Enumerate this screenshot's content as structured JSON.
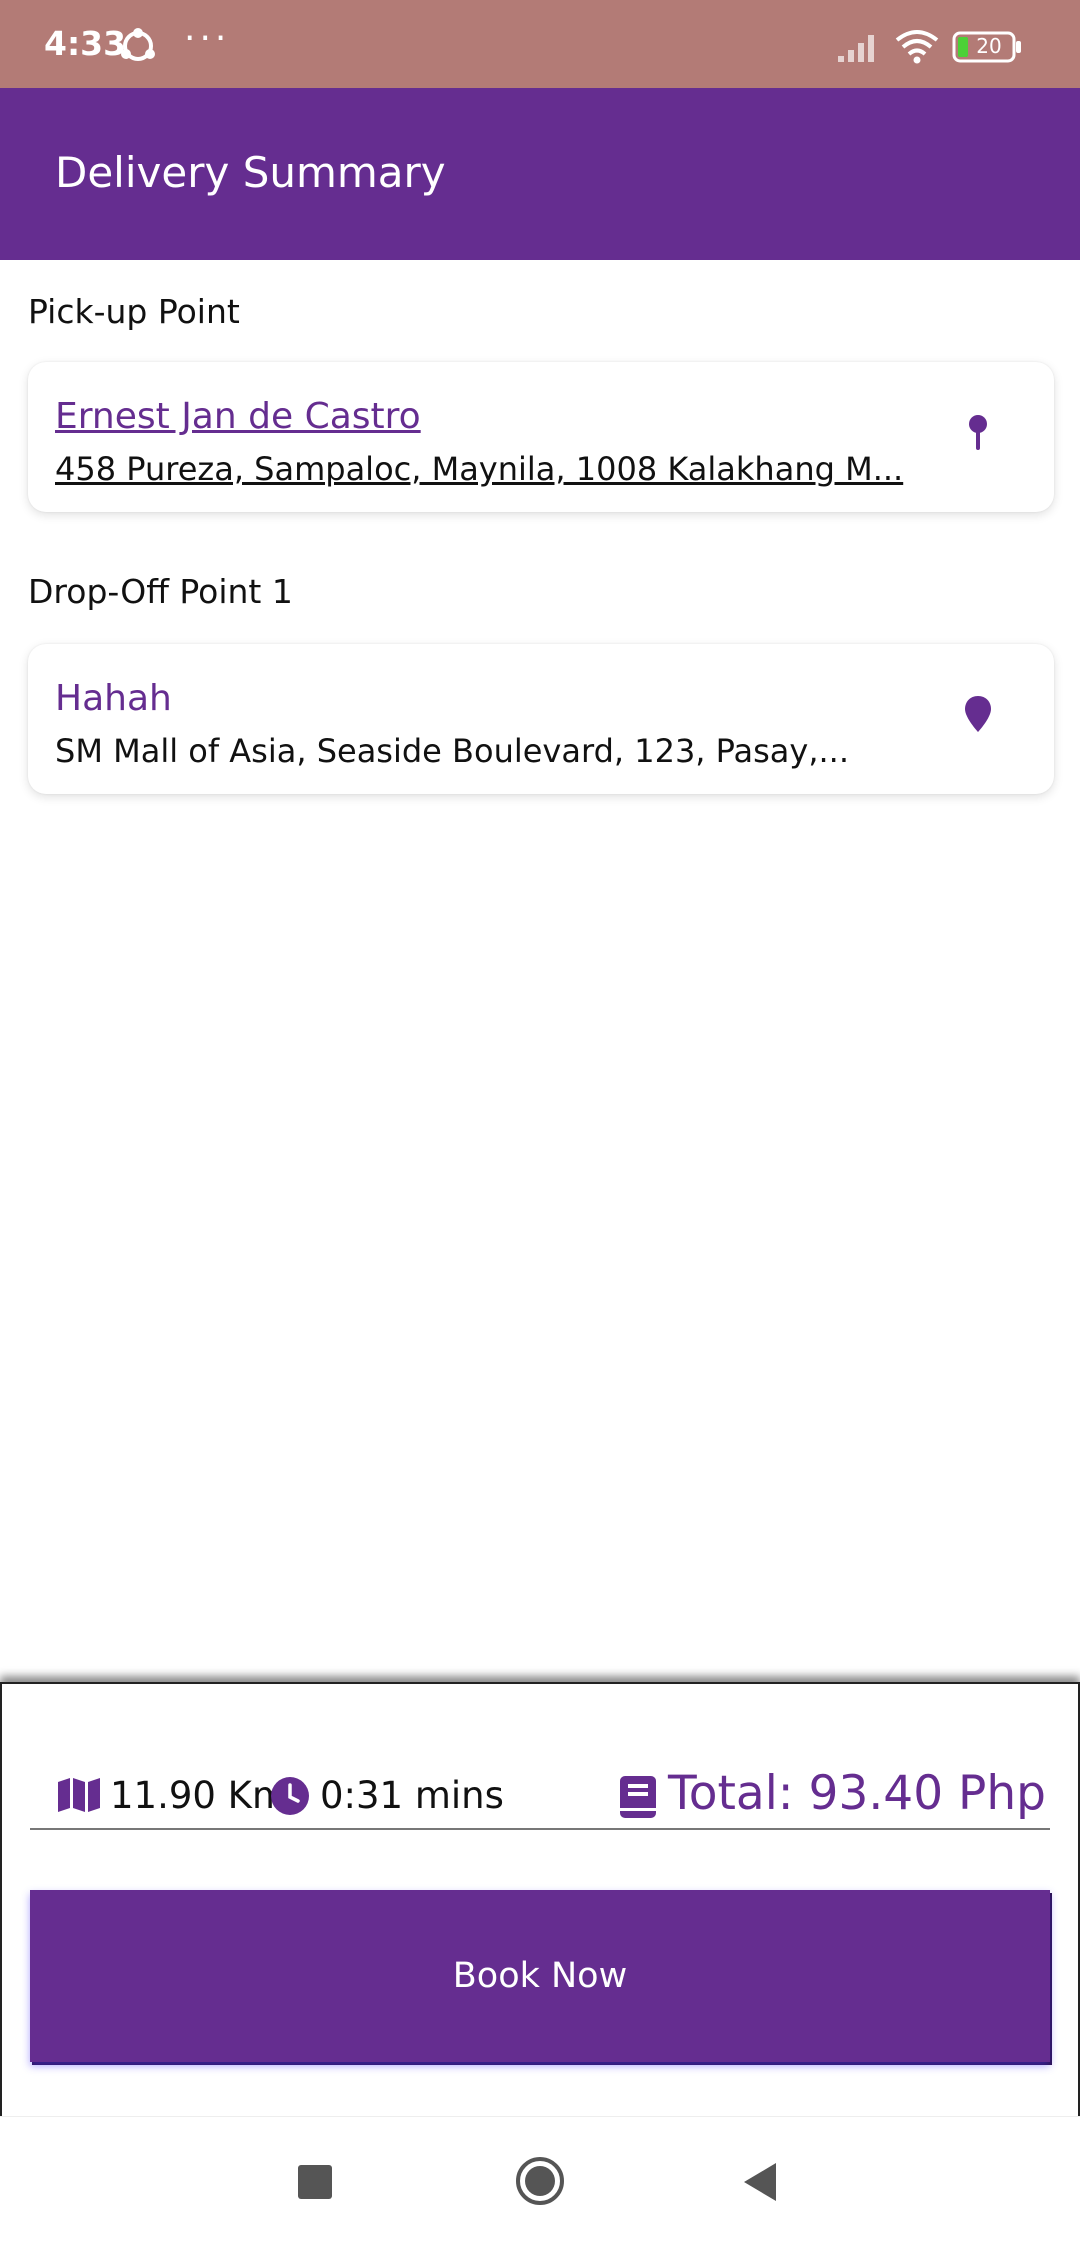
{
  "status_bar": {
    "time": "4:33",
    "more_dots": "···",
    "battery_level": "20",
    "icons": [
      "sync-icon",
      "signal-icon",
      "wifi-icon",
      "battery-icon"
    ]
  },
  "app_bar": {
    "title": "Delivery Summary"
  },
  "pickup": {
    "section_label": "Pick-up Point",
    "name": "Ernest Jan de Castro",
    "address": "458 Pureza, Sampaloc, Maynila, 1008 Kalakhang M...",
    "icon": "map-pin-icon"
  },
  "dropoff": {
    "section_label": "Drop-Off Point 1",
    "name": "Hahah",
    "address": "SM Mall of Asia, Seaside Boulevard, 123, Pasay,...",
    "icon": "map-marker-icon"
  },
  "summary": {
    "distance": "11.90 Km",
    "duration": "0:31 mins",
    "total": "Total: 93.40 Php",
    "icons": [
      "map-icon",
      "clock-icon",
      "receipt-icon"
    ]
  },
  "actions": {
    "book_label": "Book Now"
  },
  "nav_bar": {
    "icons": [
      "recent-apps-icon",
      "home-icon",
      "back-icon"
    ]
  },
  "colors": {
    "brand": "#652d90",
    "status_bar": "#b37b76"
  }
}
